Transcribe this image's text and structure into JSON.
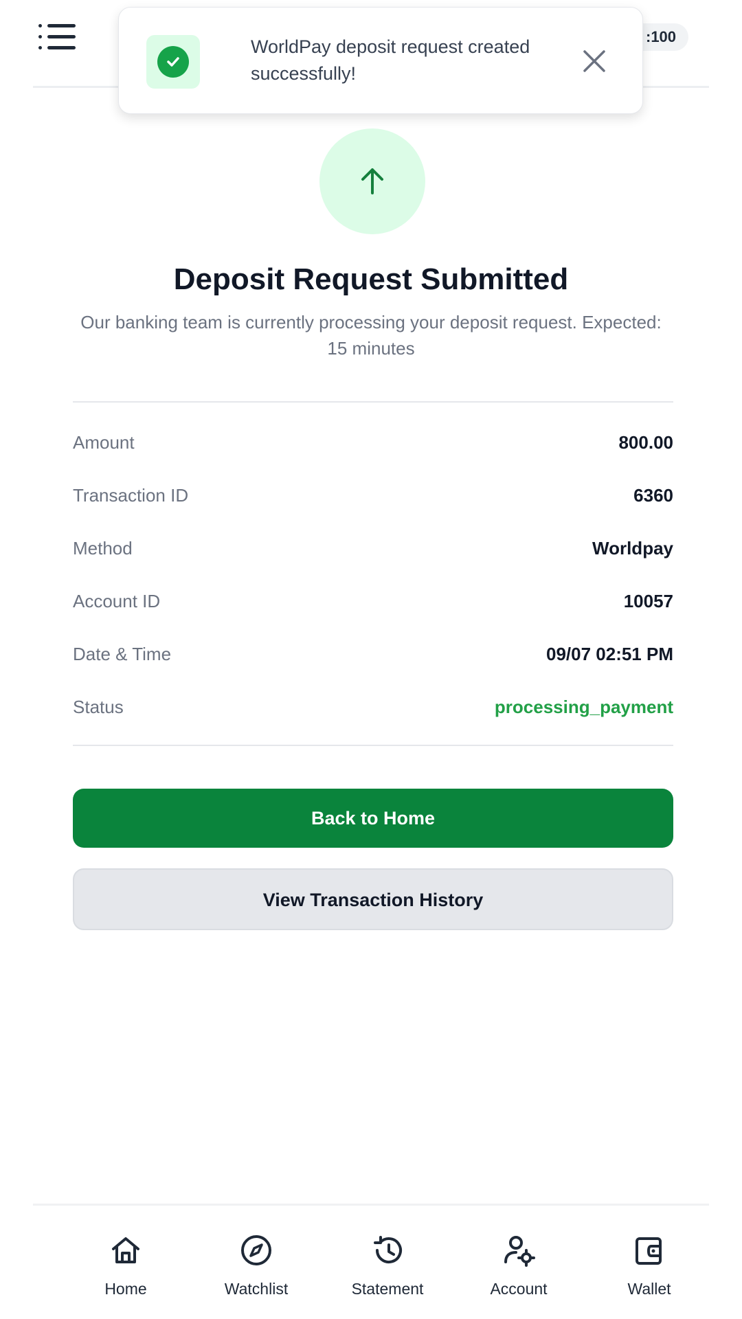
{
  "header": {
    "leverage_badge": ":100"
  },
  "toast": {
    "message": "WorldPay deposit request created successfully!"
  },
  "main": {
    "title": "Deposit Request Submitted",
    "subtitle": "Our banking team is currently processing your deposit request. Expected: 15 minutes"
  },
  "details": [
    {
      "label": "Amount",
      "value": "800.00"
    },
    {
      "label": "Transaction ID",
      "value": "6360"
    },
    {
      "label": "Method",
      "value": "Worldpay"
    },
    {
      "label": "Account ID",
      "value": "10057"
    },
    {
      "label": "Date & Time",
      "value": "09/07 02:51 PM"
    },
    {
      "label": "Status",
      "value": "processing_payment"
    }
  ],
  "buttons": {
    "primary": "Back to Home",
    "secondary": "View Transaction History"
  },
  "bottom_nav": [
    {
      "label": "Home",
      "icon": "home-icon"
    },
    {
      "label": "Watchlist",
      "icon": "compass-icon"
    },
    {
      "label": "Statement",
      "icon": "history-icon"
    },
    {
      "label": "Account",
      "icon": "user-settings-icon"
    },
    {
      "label": "Wallet",
      "icon": "wallet-icon"
    }
  ],
  "colors": {
    "primary_green": "#0a843c",
    "status_green": "#22a047",
    "success_bg": "#dcfce7"
  }
}
